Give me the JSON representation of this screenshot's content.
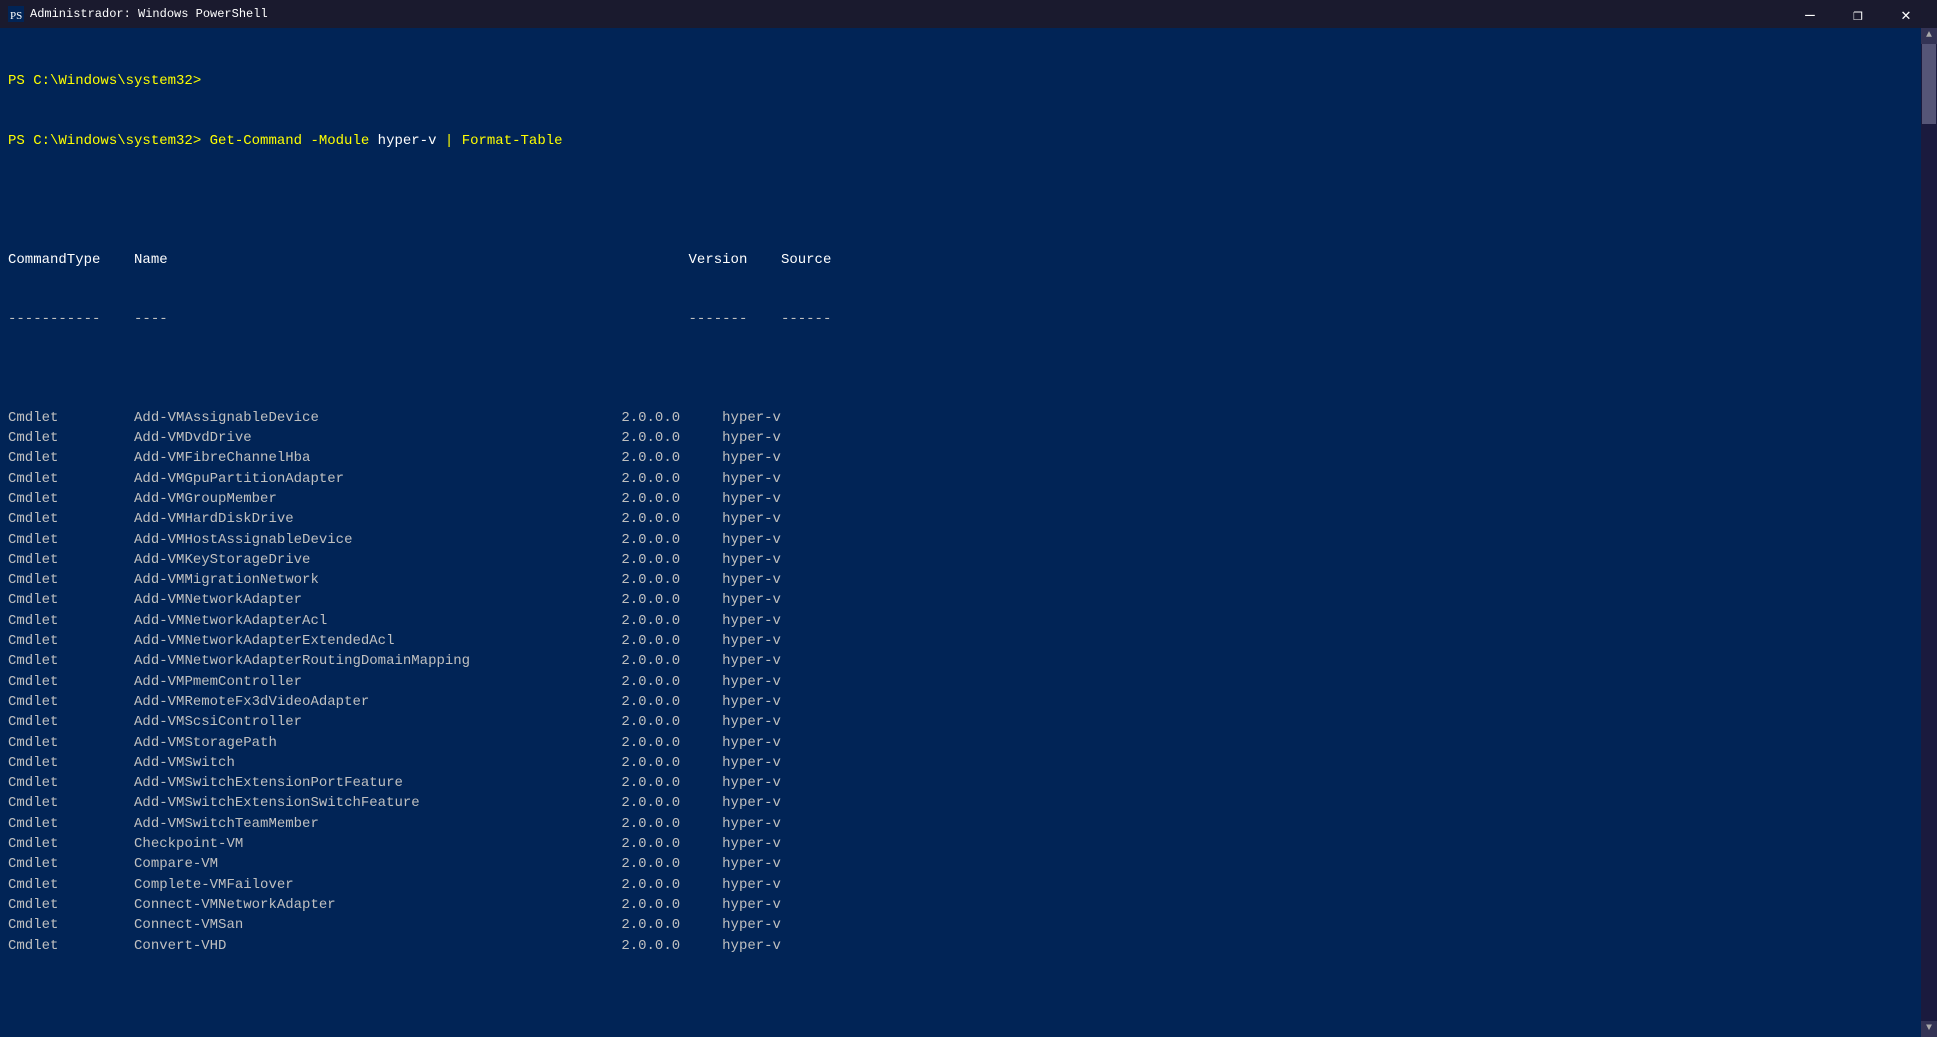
{
  "window": {
    "title": "Administrador: Windows PowerShell",
    "minimize_label": "—",
    "maximize_label": "❐",
    "close_label": "✕"
  },
  "terminal": {
    "prompt1": "PS C:\\Windows\\system32>",
    "prompt2": "PS C:\\Windows\\system32>",
    "command": " Get-Command -Module hyper-v | Format-Table",
    "headers": {
      "commandtype": "CommandType",
      "name": "Name",
      "version": "Version",
      "source": "Source"
    },
    "separators": {
      "commandtype": "-----------",
      "name": "----",
      "version": "-------",
      "source": "------"
    },
    "rows": [
      {
        "type": "Cmdlet",
        "name": "Add-VMAssignableDevice",
        "version": "2.0.0.0",
        "source": "hyper-v"
      },
      {
        "type": "Cmdlet",
        "name": "Add-VMDvdDrive",
        "version": "2.0.0.0",
        "source": "hyper-v"
      },
      {
        "type": "Cmdlet",
        "name": "Add-VMFibreChannelHba",
        "version": "2.0.0.0",
        "source": "hyper-v"
      },
      {
        "type": "Cmdlet",
        "name": "Add-VMGpuPartitionAdapter",
        "version": "2.0.0.0",
        "source": "hyper-v"
      },
      {
        "type": "Cmdlet",
        "name": "Add-VMGroupMember",
        "version": "2.0.0.0",
        "source": "hyper-v"
      },
      {
        "type": "Cmdlet",
        "name": "Add-VMHardDiskDrive",
        "version": "2.0.0.0",
        "source": "hyper-v"
      },
      {
        "type": "Cmdlet",
        "name": "Add-VMHostAssignableDevice",
        "version": "2.0.0.0",
        "source": "hyper-v"
      },
      {
        "type": "Cmdlet",
        "name": "Add-VMKeyStorageDrive",
        "version": "2.0.0.0",
        "source": "hyper-v"
      },
      {
        "type": "Cmdlet",
        "name": "Add-VMMigrationNetwork",
        "version": "2.0.0.0",
        "source": "hyper-v"
      },
      {
        "type": "Cmdlet",
        "name": "Add-VMNetworkAdapter",
        "version": "2.0.0.0",
        "source": "hyper-v"
      },
      {
        "type": "Cmdlet",
        "name": "Add-VMNetworkAdapterAcl",
        "version": "2.0.0.0",
        "source": "hyper-v"
      },
      {
        "type": "Cmdlet",
        "name": "Add-VMNetworkAdapterExtendedAcl",
        "version": "2.0.0.0",
        "source": "hyper-v"
      },
      {
        "type": "Cmdlet",
        "name": "Add-VMNetworkAdapterRoutingDomainMapping",
        "version": "2.0.0.0",
        "source": "hyper-v"
      },
      {
        "type": "Cmdlet",
        "name": "Add-VMPmemController",
        "version": "2.0.0.0",
        "source": "hyper-v"
      },
      {
        "type": "Cmdlet",
        "name": "Add-VMRemoteFx3dVideoAdapter",
        "version": "2.0.0.0",
        "source": "hyper-v"
      },
      {
        "type": "Cmdlet",
        "name": "Add-VMScsiController",
        "version": "2.0.0.0",
        "source": "hyper-v"
      },
      {
        "type": "Cmdlet",
        "name": "Add-VMStoragePath",
        "version": "2.0.0.0",
        "source": "hyper-v"
      },
      {
        "type": "Cmdlet",
        "name": "Add-VMSwitch",
        "version": "2.0.0.0",
        "source": "hyper-v"
      },
      {
        "type": "Cmdlet",
        "name": "Add-VMSwitchExtensionPortFeature",
        "version": "2.0.0.0",
        "source": "hyper-v"
      },
      {
        "type": "Cmdlet",
        "name": "Add-VMSwitchExtensionSwitchFeature",
        "version": "2.0.0.0",
        "source": "hyper-v"
      },
      {
        "type": "Cmdlet",
        "name": "Add-VMSwitchTeamMember",
        "version": "2.0.0.0",
        "source": "hyper-v"
      },
      {
        "type": "Cmdlet",
        "name": "Checkpoint-VM",
        "version": "2.0.0.0",
        "source": "hyper-v"
      },
      {
        "type": "Cmdlet",
        "name": "Compare-VM",
        "version": "2.0.0.0",
        "source": "hyper-v"
      },
      {
        "type": "Cmdlet",
        "name": "Complete-VMFailover",
        "version": "2.0.0.0",
        "source": "hyper-v"
      },
      {
        "type": "Cmdlet",
        "name": "Connect-VMNetworkAdapter",
        "version": "2.0.0.0",
        "source": "hyper-v"
      },
      {
        "type": "Cmdlet",
        "name": "Connect-VMSan",
        "version": "2.0.0.0",
        "source": "hyper-v"
      },
      {
        "type": "Cmdlet",
        "name": "Convert-VHD",
        "version": "2.0.0.0",
        "source": "hyper-v"
      }
    ]
  }
}
